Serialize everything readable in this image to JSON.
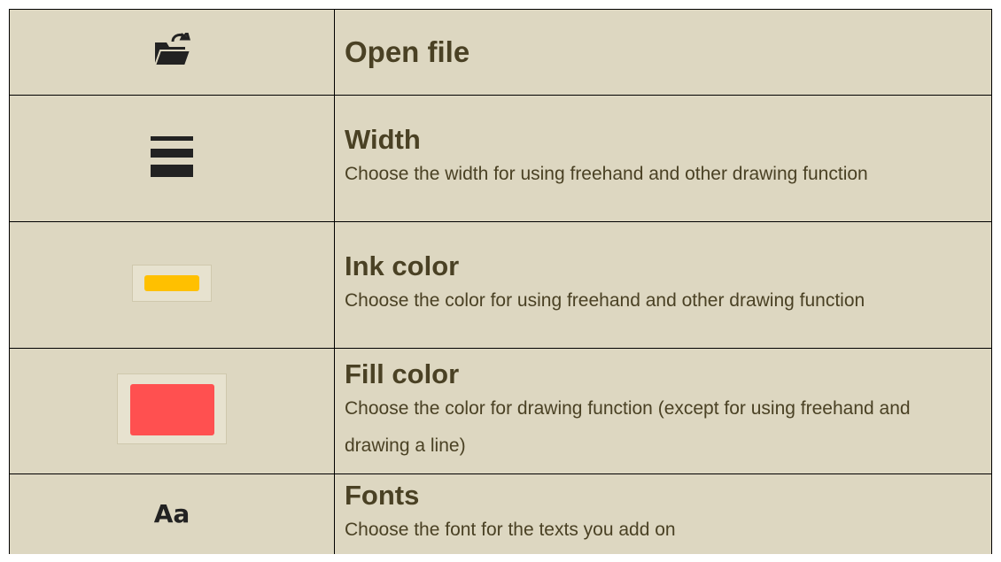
{
  "rows": [
    {
      "icon": "open-folder-icon",
      "title": "Open file",
      "description": ""
    },
    {
      "icon": "line-width-icon",
      "title": "Width",
      "description": "Choose the width for using freehand and other drawing function"
    },
    {
      "icon": "ink-color-swatch-icon",
      "icon_color": "#ffc000",
      "title": "Ink color",
      "description": "Choose the color for using freehand and other drawing function"
    },
    {
      "icon": "fill-color-swatch-icon",
      "icon_color": "#ff5050",
      "title": "Fill color",
      "description": "Choose the color for drawing function (except for using freehand and drawing a line)"
    },
    {
      "icon": "fonts-icon",
      "icon_text": "Aa",
      "title": "Fonts",
      "description": "Choose the font for the texts you add on"
    }
  ],
  "colors": {
    "background": "#ddd7c1",
    "text": "#4a4124",
    "icon_dark": "#222222"
  }
}
